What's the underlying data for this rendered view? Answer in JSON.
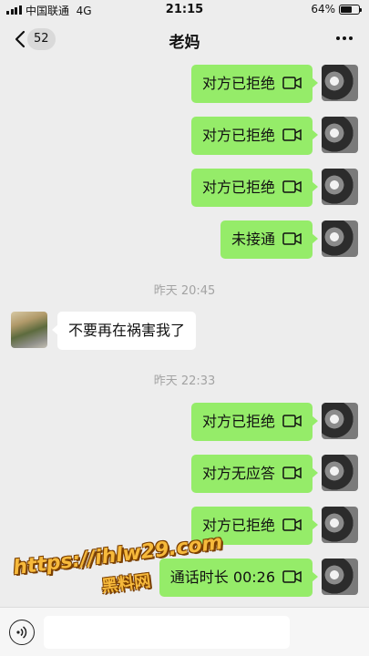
{
  "status_bar": {
    "carrier": "中国联通",
    "network": "4G",
    "time": "21:15",
    "battery_percent": "64%",
    "battery_level": 0.64
  },
  "nav": {
    "unread_count": "52",
    "title": "老妈"
  },
  "messages": [
    {
      "type": "call",
      "direction": "out",
      "text": "对方已拒绝",
      "icon": "video-call-icon"
    },
    {
      "type": "call",
      "direction": "out",
      "text": "对方已拒绝",
      "icon": "video-call-icon"
    },
    {
      "type": "call",
      "direction": "out",
      "text": "对方已拒绝",
      "icon": "video-call-icon"
    },
    {
      "type": "call",
      "direction": "out",
      "text": "未接通",
      "icon": "video-call-icon"
    },
    {
      "type": "time",
      "text": "昨天 20:45"
    },
    {
      "type": "text",
      "direction": "in",
      "text": "不要再在祸害我了"
    },
    {
      "type": "time",
      "text": "昨天 22:33"
    },
    {
      "type": "call",
      "direction": "out",
      "text": "对方已拒绝",
      "icon": "video-call-icon"
    },
    {
      "type": "call",
      "direction": "out",
      "text": "对方无应答",
      "icon": "video-call-icon"
    },
    {
      "type": "call",
      "direction": "out",
      "text": "对方已拒绝",
      "icon": "video-call-icon"
    },
    {
      "type": "call",
      "direction": "out",
      "text": "通话时长 00:26",
      "icon": "video-call-icon"
    }
  ],
  "watermark": {
    "url": "https://ihlw29.com",
    "name": "黑料网"
  },
  "colors": {
    "outgoing_bubble": "#95ec69",
    "incoming_bubble": "#ffffff",
    "background": "#ededed",
    "watermark": "#f6b93b"
  }
}
